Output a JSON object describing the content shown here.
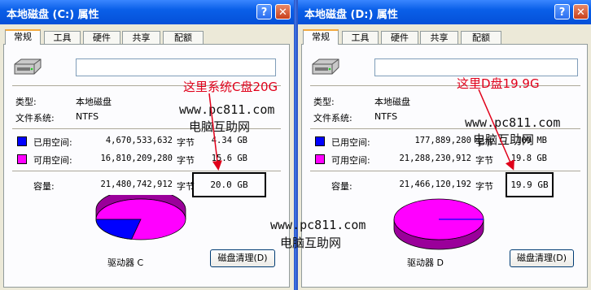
{
  "tabs": [
    "常规",
    "工具",
    "硬件",
    "共享",
    "配额"
  ],
  "left_window": {
    "title": "本地磁盘 (C:) 属性",
    "name_value": "",
    "type_label": "类型:",
    "type_value": "本地磁盘",
    "fs_label": "文件系统:",
    "fs_value": "NTFS",
    "used_label": "已用空间:",
    "used_bytes": "4,670,533,632",
    "used_unit": "字节",
    "used_gb": "4.34 GB",
    "free_label": "可用空间:",
    "free_bytes": "16,810,209,280",
    "free_unit": "字节",
    "free_gb": "15.6 GB",
    "cap_label": "容量:",
    "cap_bytes": "21,480,742,912",
    "cap_unit": "字节",
    "cap_gb": "20.0 GB",
    "drive_label": "驱动器 C",
    "cleanup_button": "磁盘清理(D)",
    "used_fraction": 0.217,
    "annotation": "这里系统C盘20G"
  },
  "right_window": {
    "title": "本地磁盘 (D:) 属性",
    "name_value": "",
    "type_label": "类型:",
    "type_value": "本地磁盘",
    "fs_label": "文件系统:",
    "fs_value": "NTFS",
    "used_label": "已用空间:",
    "used_bytes": "177,889,280",
    "used_unit": "字节",
    "used_gb": "169 MB",
    "free_label": "可用空间:",
    "free_bytes": "21,288,230,912",
    "free_unit": "字节",
    "free_gb": "19.8 GB",
    "cap_label": "容量:",
    "cap_bytes": "21,466,120,192",
    "cap_unit": "字节",
    "cap_gb": "19.9 GB",
    "drive_label": "驱动器 D",
    "cleanup_button": "磁盘清理(D)",
    "used_fraction": 0.008,
    "annotation": "这里D盘19.9G"
  },
  "watermark": {
    "url": "www.pc811.com",
    "name": "电脑互助网"
  },
  "colors": {
    "used": "#0000ff",
    "free": "#ff00ff",
    "annotation": "#e0001a"
  },
  "icons": {
    "help": "question-mark-icon",
    "close": "close-x-icon",
    "drive": "hard-drive-icon"
  }
}
